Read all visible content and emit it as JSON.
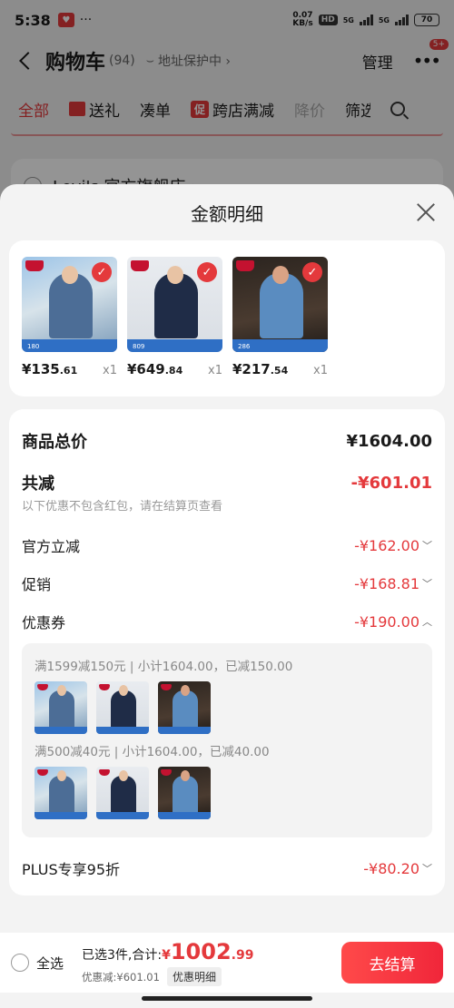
{
  "status_bar": {
    "time": "5:38",
    "dots": "···",
    "net_speed_value": "0.07",
    "net_speed_unit": "KB/s",
    "hd": "HD",
    "signal1": "5G",
    "signal2": "5G",
    "battery": "70"
  },
  "header": {
    "title": "购物车",
    "count": "(94)",
    "address_protect": "地址保护中 ›",
    "manage": "管理",
    "more": "•••",
    "badge": "5+"
  },
  "tabs": [
    {
      "label": "全部"
    },
    {
      "label": "送礼"
    },
    {
      "label": "凑单"
    },
    {
      "label": "跨店满减",
      "tag": "促"
    },
    {
      "label": "降价"
    },
    {
      "label": "筛选"
    }
  ],
  "store": {
    "name": "Levi's 官方旗舰店 ›"
  },
  "sheet": {
    "title": "金额明细",
    "products": [
      {
        "price_int": "¥135",
        "price_dec": ".61",
        "qty": "x1",
        "sold": "180"
      },
      {
        "price_int": "¥649",
        "price_dec": ".84",
        "qty": "x1",
        "sold": "809"
      },
      {
        "price_int": "¥217",
        "price_dec": ".54",
        "qty": "x1",
        "sold": "286"
      }
    ],
    "rows": {
      "total_label": "商品总价",
      "total_value": "¥1604.00",
      "discount_label": "共减",
      "discount_value": "-¥601.01",
      "discount_note": "以下优惠不包含红包，请在结算页查看",
      "official_label": "官方立减",
      "official_value": "-¥162.00",
      "promo_label": "促销",
      "promo_value": "-¥168.81",
      "coupon_label": "优惠券",
      "coupon_value": "-¥190.00",
      "plus_label": "PLUS专享95折",
      "plus_value": "-¥80.20"
    },
    "coupon_lines": [
      "满1599减150元 | 小计1604.00，已减150.00",
      "满500减40元 | 小计1604.00，已减40.00"
    ]
  },
  "bottom": {
    "select_all": "全选",
    "selected_text": "已选3件,合计:",
    "currency": "¥",
    "total_int": "1002",
    "total_dec": ".99",
    "discount_text": "优惠减:¥601.01",
    "detail_chip": "优惠明细",
    "checkout": "去结算"
  },
  "colors": {
    "accent": "#e4393c",
    "checkout": "#f0263a"
  }
}
